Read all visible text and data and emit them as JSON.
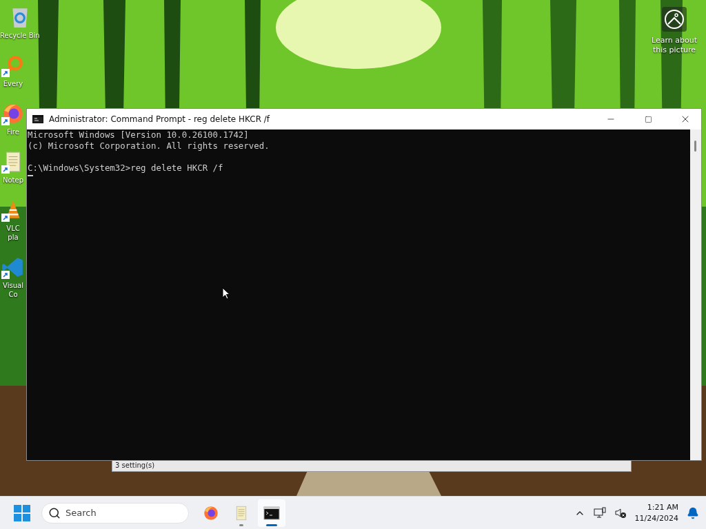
{
  "desktop": {
    "icons": [
      {
        "kind": "recycle-bin",
        "label": "Recycle Bin",
        "shortcut": false
      },
      {
        "kind": "magnifier",
        "label": "Every",
        "shortcut": true
      },
      {
        "kind": "firefox",
        "label": "Fire",
        "shortcut": true
      },
      {
        "kind": "notepad",
        "label": "Notep",
        "shortcut": true
      },
      {
        "kind": "vlc",
        "label": "VLC\npla",
        "shortcut": true
      },
      {
        "kind": "vscode",
        "label": "Visual\nCo",
        "shortcut": true
      }
    ],
    "spotlight": {
      "label": "Learn about this picture"
    }
  },
  "background_window": {
    "status": "3 setting(s)"
  },
  "console_window": {
    "title": "Administrator: Command Prompt - reg  delete HKCR /f",
    "lines": [
      "Microsoft Windows [Version 10.0.26100.1742]",
      "(c) Microsoft Corporation. All rights reserved."
    ],
    "prompt": "C:\\Windows\\System32>reg delete HKCR /f"
  },
  "taskbar": {
    "search": {
      "placeholder": "Search"
    },
    "apps": [
      {
        "kind": "firefox",
        "running": false,
        "selected": false
      },
      {
        "kind": "notepad",
        "running": true,
        "selected": false
      },
      {
        "kind": "terminal",
        "running": true,
        "selected": true
      }
    ],
    "clock": {
      "time": "1:21 AM",
      "date": "11/24/2024"
    }
  }
}
